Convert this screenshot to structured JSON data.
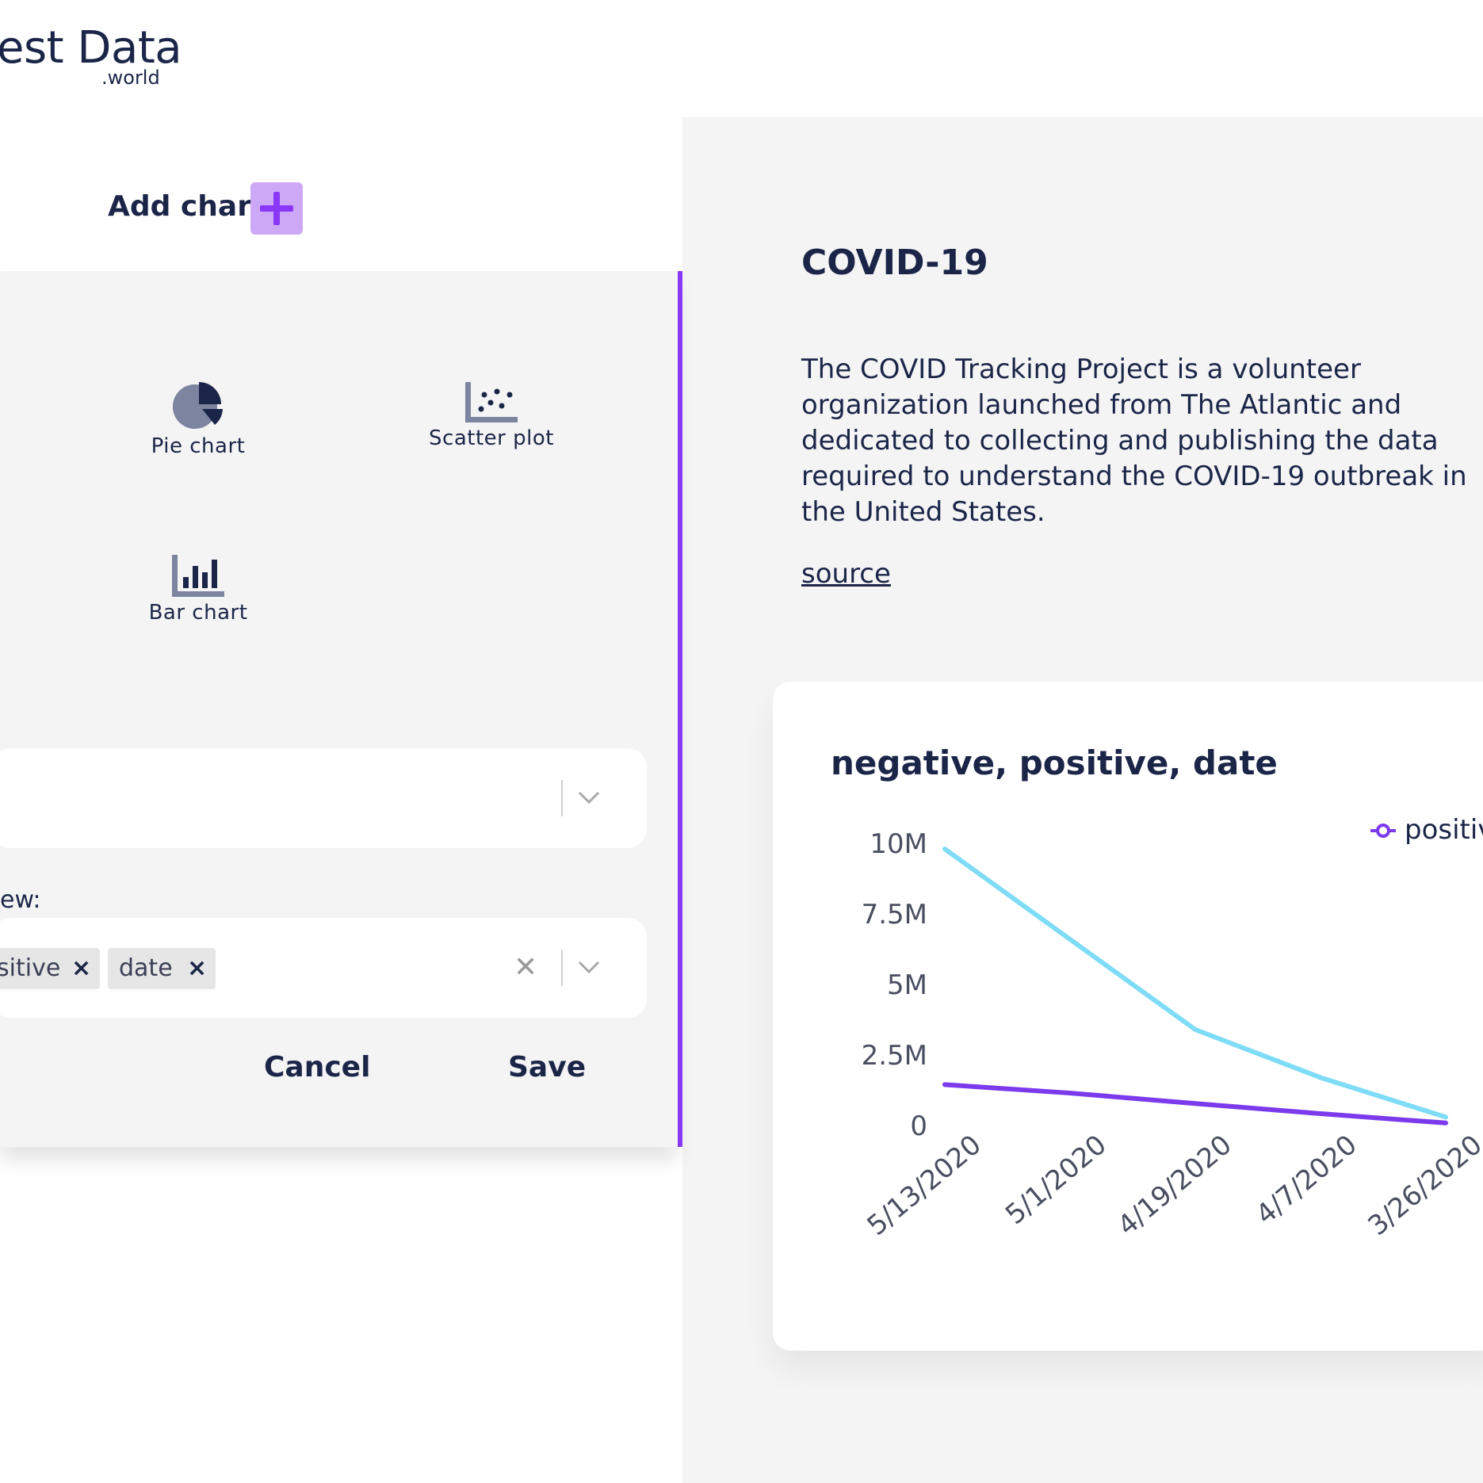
{
  "logo": {
    "main": "est Data",
    "sub": ".world"
  },
  "add_chart": {
    "label": "Add chart"
  },
  "chart_types": [
    {
      "label": "Pie chart",
      "icon": "pie-chart-icon"
    },
    {
      "label": "Scatter plot",
      "icon": "scatter-plot-icon"
    },
    {
      "label": "Bar chart",
      "icon": "bar-chart-icon"
    }
  ],
  "fields": {
    "view_label": "ew:",
    "selected_tags": [
      "sitive",
      "date"
    ]
  },
  "actions": {
    "cancel": "Cancel",
    "save": "Save"
  },
  "dataset": {
    "title": "COVID-19",
    "description": "The COVID Tracking Project is a volunteer organization launched from The Atlantic and dedicated to collecting and publishing the data required to understand the COVID-19 outbreak in the United States.",
    "source_link": "source"
  },
  "colors": {
    "accent": "#8a38f5",
    "accent_light": "#cda8f7",
    "navy": "#1b2548",
    "series_negative": "#7fdcf7",
    "series_positive": "#7c3aed"
  },
  "chart_data": {
    "type": "line",
    "title": "negative, positive, date",
    "xlabel": "",
    "ylabel": "",
    "ylim": [
      0,
      10000000
    ],
    "yticks": [
      "0",
      "2.5M",
      "5M",
      "7.5M",
      "10M"
    ],
    "categories": [
      "5/13/2020",
      "5/1/2020",
      "4/19/2020",
      "4/7/2020",
      "3/26/2020"
    ],
    "series": [
      {
        "key": "negative",
        "values": [
          9800000,
          6600000,
          3400000,
          1700000,
          300000
        ]
      },
      {
        "name": "positiv",
        "values": [
          1450000,
          1150000,
          780000,
          420000,
          90000
        ]
      }
    ],
    "legend": "top-right"
  }
}
